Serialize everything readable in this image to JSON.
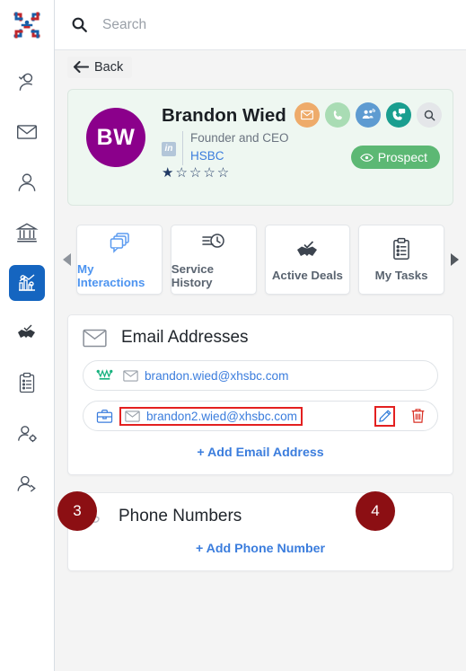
{
  "app": {
    "logo_icon": "pinwheel-logo"
  },
  "sidebar": {
    "items": [
      {
        "icon": "user-check-icon",
        "name": "contacts-verify",
        "active": false
      },
      {
        "icon": "envelope-icon",
        "name": "mail",
        "active": false
      },
      {
        "icon": "user-icon",
        "name": "person",
        "active": false
      },
      {
        "icon": "bank-icon",
        "name": "institutions",
        "active": false
      },
      {
        "icon": "analytics-gears-icon",
        "name": "analytics",
        "active": true
      },
      {
        "icon": "handshake-check-icon",
        "name": "deals",
        "active": false
      },
      {
        "icon": "clipboard-list-icon",
        "name": "tasks",
        "active": false
      },
      {
        "icon": "user-gear-icon",
        "name": "user-settings",
        "active": false
      },
      {
        "icon": "user-arrow-icon",
        "name": "user-transfer",
        "active": false
      }
    ]
  },
  "search": {
    "placeholder": "Search",
    "value": "",
    "icon": "search-icon"
  },
  "back": {
    "label": "Back",
    "icon": "arrow-left-icon"
  },
  "contact": {
    "initials": "BW",
    "name": "Brandon Wied",
    "title": "Founder and CEO",
    "company": "HSBC",
    "linkedin_badge": "in",
    "rating": 1,
    "rating_max": 5,
    "star_filled": "★",
    "star_empty": "☆",
    "status_badge": {
      "label": "Prospect",
      "icon": "eye-icon",
      "color": "#5cb874"
    },
    "avatar_color": "#8b008b",
    "actions": [
      {
        "name": "send-email-action",
        "icon": "envelope-icon",
        "color": "#eeab6a"
      },
      {
        "name": "call-action",
        "icon": "phone-icon",
        "color": "#a9dcb4"
      },
      {
        "name": "conference-call-action",
        "icon": "group-call-icon",
        "color": "#5e9bd1"
      },
      {
        "name": "chat-call-action",
        "icon": "phone-chat-icon",
        "color": "#1a9e8f"
      },
      {
        "name": "lookup-action",
        "icon": "search-icon",
        "color": "#e4e6e9"
      }
    ]
  },
  "tabs": {
    "prev_arrow": "triangle-left-icon",
    "next_arrow": "triangle-right-icon",
    "items": [
      {
        "label": "My Interactions",
        "icon": "chat-stack-icon",
        "active": true
      },
      {
        "label": "Service History",
        "icon": "history-clock-icon",
        "active": false
      },
      {
        "label": "Active Deals",
        "icon": "handshake-check-icon",
        "active": false
      },
      {
        "label": "My Tasks",
        "icon": "clipboard-list-icon",
        "active": false
      }
    ]
  },
  "email_section": {
    "title": "Email Addresses",
    "icon": "envelope-icon",
    "add_label": "+ Add Email Address",
    "rows": [
      {
        "type_icon": "crown-icon",
        "type_color": "#18b27f",
        "value": "brandon.wied@xhsbc.com",
        "value_icon": "envelope-icon",
        "highlighted": false,
        "show_actions": false
      },
      {
        "type_icon": "briefcase-icon",
        "type_color": "#3b7ddd",
        "value": "brandon2.wied@xhsbc.com",
        "value_icon": "envelope-icon",
        "highlighted": true,
        "show_actions": true,
        "edit_icon": "pencil-icon",
        "edit_highlighted": true,
        "delete_icon": "trash-icon"
      }
    ]
  },
  "phone_section": {
    "title": "Phone Numbers",
    "icon": "phone-icon",
    "add_label": "+ Add Phone Number"
  },
  "annotations": [
    {
      "id": "anno-3",
      "label": "3",
      "color": "#8c0f13"
    },
    {
      "id": "anno-4",
      "label": "4",
      "color": "#8c0f13"
    }
  ]
}
